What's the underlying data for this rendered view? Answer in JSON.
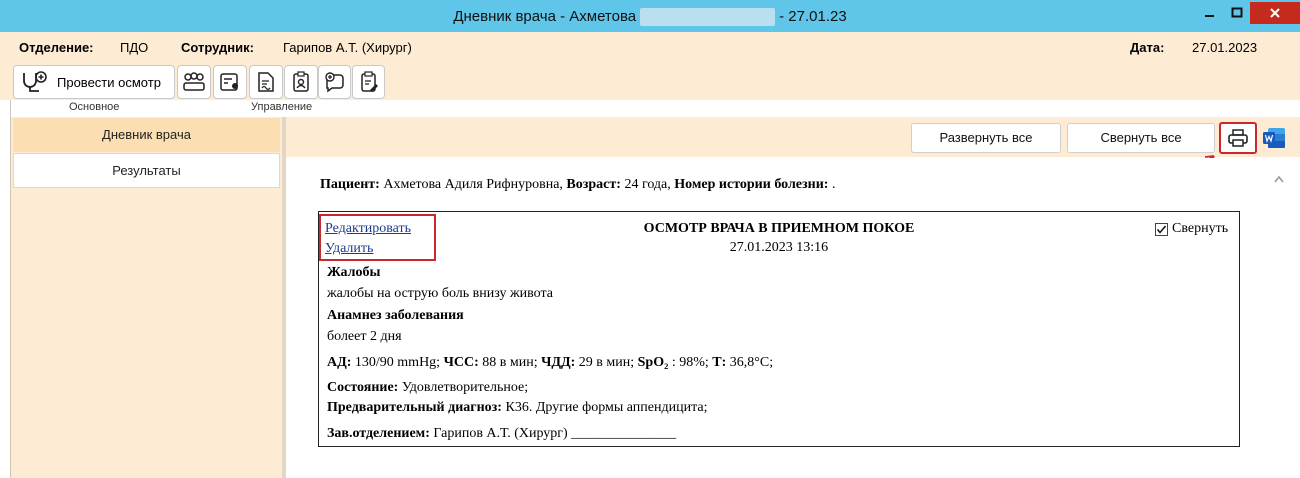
{
  "window": {
    "title_prefix": "Дневник врача - Ахметова",
    "title_suffix": "- 27.01.23"
  },
  "info": {
    "department_label": "Отделение:",
    "department_value": "ПДО",
    "employee_label": "Сотрудник:",
    "employee_value": "Гарипов А.Т. (Хирург)",
    "date_label": "Дата:",
    "date_value": "27.01.2023"
  },
  "toolbar": {
    "exam_button_label": "Провести осмотр",
    "group_main": "Основное",
    "group_manage": "Управление",
    "icons": [
      "stethoscope-plus-icon",
      "patients-group-icon",
      "card-user-icon",
      "document-sign-icon",
      "id-badge-icon",
      "chat-plus-icon",
      "clipboard-edit-icon"
    ]
  },
  "left_tabs": {
    "diary": "Дневник врача",
    "results": "Результаты"
  },
  "actions": {
    "expand_all": "Развернуть все",
    "collapse_all": "Свернуть все"
  },
  "patient_line": {
    "patient_label": "Пациент:",
    "patient_name": "Ахметова Адиля Рифнуровна,",
    "age_label": "Возраст:",
    "age_value": "24 года,",
    "history_label": "Номер истории болезни:",
    "history_value": "."
  },
  "card": {
    "edit_link": "Редактировать",
    "delete_link": "Удалить",
    "title": "ОСМОТР ВРАЧА В ПРИЕМНОМ ПОКОЕ",
    "datetime": "27.01.2023 13:16",
    "collapse_label": "Свернуть",
    "complaints_heading": "Жалобы",
    "complaints_text": "жалобы на острую боль внизу живота",
    "anamnesis_heading": "Анамнез заболевания",
    "anamnesis_text": "болеет 2 дня",
    "bp_label": "АД:",
    "bp_value": "130/90 mmHg;",
    "hr_label": "ЧСС:",
    "hr_value": "88 в мин;",
    "rr_label": "ЧДД:",
    "rr_value": "29 в мин;",
    "spo2_label": "SpO₂",
    "spo2_value": ": 98%;",
    "temp_label": "Т:",
    "temp_value": "36,8°С;",
    "state_label": "Состояние:",
    "state_value": "Удовлетворительное;",
    "diagnosis_label": "Предварительный диагноз:",
    "diagnosis_value": "К36. Другие формы аппендицита;",
    "head_label": "Зав.отделением:",
    "head_value": "Гарипов А.Т. (Хирург) _______________"
  },
  "colors": {
    "titlebar": "#5fc6ea",
    "panel": "#fdebd3",
    "highlight": "#c9282d",
    "link": "#1a3c8f"
  }
}
